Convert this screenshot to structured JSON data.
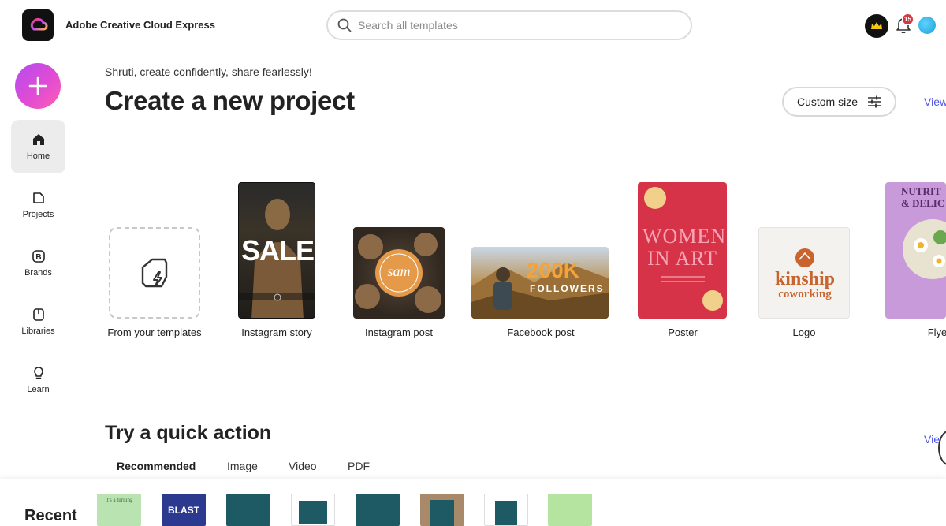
{
  "app": {
    "title": "Adobe Creative Cloud Express",
    "search_placeholder": "Search all templates",
    "notification_count": "15"
  },
  "sidebar": {
    "items": [
      {
        "label": "Home",
        "icon": "home-icon"
      },
      {
        "label": "Projects",
        "icon": "projects-icon"
      },
      {
        "label": "Brands",
        "icon": "brands-icon"
      },
      {
        "label": "Libraries",
        "icon": "libraries-icon"
      },
      {
        "label": "Learn",
        "icon": "learn-icon"
      }
    ]
  },
  "main": {
    "greeting": "Shruti, create confidently, share fearlessly!",
    "title": "Create a new project",
    "custom_size_label": "Custom size",
    "view_all_label": "View",
    "cards": [
      {
        "label": "From your templates"
      },
      {
        "label": "Instagram story",
        "text": "SALE"
      },
      {
        "label": "Instagram post",
        "text": "sam"
      },
      {
        "label": "Facebook post",
        "text": "200K",
        "subtext": "FOLLOWERS"
      },
      {
        "label": "Poster",
        "text": "WOMEN IN ART"
      },
      {
        "label": "Logo",
        "text": "kinship",
        "subtext": "coworking"
      },
      {
        "label": "Flye",
        "text": "NUTRIT & DELIC"
      }
    ]
  },
  "quick_action": {
    "title": "Try a quick action",
    "view_all_label": "Vie",
    "tabs": [
      "Recommended",
      "Image",
      "Video",
      "PDF"
    ],
    "active_tab": "Recommended"
  },
  "recent": {
    "title": "Recent",
    "thumbs": [
      {
        "color": "#b9e3b0",
        "text": "It's a turning"
      },
      {
        "color": "#2b3a8f",
        "text": "BLAST"
      },
      {
        "color": "#1e5a63",
        "text": ""
      },
      {
        "color": "#ffffff",
        "text": ""
      },
      {
        "color": "#1e5a63",
        "text": ""
      },
      {
        "color": "#a88a6a",
        "text": ""
      },
      {
        "color": "#ffffff",
        "text": ""
      },
      {
        "color": "#b5e3a0",
        "text": ""
      }
    ]
  },
  "colors": {
    "accent": "#5258e4",
    "fab_gradient_start": "#b44df0",
    "fab_gradient_end": "#ff5fb0",
    "badge": "#d7373f"
  }
}
